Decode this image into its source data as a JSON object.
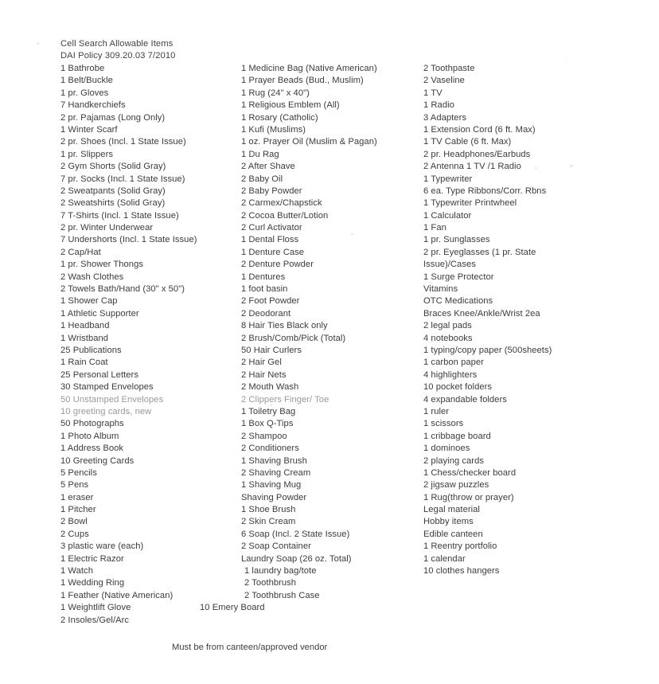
{
  "document": {
    "title": "Cell Search Allowable Items",
    "policy": "DAI Policy 309.20.03 7/2010",
    "footer_note": "Must be from canteen/approved vendor"
  },
  "columns": {
    "column_1": [
      {
        "text": "1 Bathrobe"
      },
      {
        "text": "1 Belt/Buckle"
      },
      {
        "text": "1 pr. Gloves"
      },
      {
        "text": "7 Handkerchiefs"
      },
      {
        "text": "2 pr. Pajamas (Long Only)"
      },
      {
        "text": "1 Winter Scarf"
      },
      {
        "text": "2 pr. Shoes (Incl. 1 State Issue)"
      },
      {
        "text": "1 pr. Slippers"
      },
      {
        "text": "2 Gym Shorts (Solid Gray)"
      },
      {
        "text": "7 pr. Socks (Incl. 1 State Issue)"
      },
      {
        "text": "2 Sweatpants (Solid Gray)"
      },
      {
        "text": "2 Sweatshirts (Solid Gray)"
      },
      {
        "text": "7 T-Shirts (Incl. 1 State Issue)"
      },
      {
        "text": "2 pr. Winter Underwear"
      },
      {
        "text": "7 Undershorts (Incl. 1 State Issue)"
      },
      {
        "text": "2 Cap/Hat"
      },
      {
        "text": "1 pr. Shower Thongs"
      },
      {
        "text": "2 Wash Clothes"
      },
      {
        "text": "2 Towels Bath/Hand (30\" x 50\")"
      },
      {
        "text": "1 Shower Cap"
      },
      {
        "text": "1 Athletic Supporter"
      },
      {
        "text": "1 Headband"
      },
      {
        "text": "1 Wristband"
      },
      {
        "text": "25 Publications"
      },
      {
        "text": "1 Rain Coat"
      },
      {
        "text": "25 Personal Letters"
      },
      {
        "text": "30 Stamped Envelopes"
      },
      {
        "text": "50 Unstamped Envelopes",
        "faded": true
      },
      {
        "text": "10 greeting cards, new",
        "faded": true
      },
      {
        "text": "50 Photographs"
      },
      {
        "text": "1 Photo Album"
      },
      {
        "text": "1 Address Book"
      },
      {
        "text": "10 Greeting Cards"
      },
      {
        "text": "5 Pencils"
      },
      {
        "text": "5 Pens"
      },
      {
        "text": "1 eraser"
      },
      {
        "text": "1 Pitcher"
      },
      {
        "text": "2 Bowl"
      },
      {
        "text": "2 Cups"
      },
      {
        "text": "3 plastic ware (each)"
      },
      {
        "text": "1 Electric Razor"
      },
      {
        "text": "1 Watch"
      },
      {
        "text": "1 Wedding Ring"
      },
      {
        "text": "1 Feather (Native American)"
      },
      {
        "text": "1 Weightlift Glove"
      },
      {
        "text": " 2 Insoles/Gel/Arc"
      }
    ],
    "column_2": [
      {
        "text": "1 Medicine Bag (Native American)"
      },
      {
        "text": "1 Prayer Beads (Bud., Muslim)"
      },
      {
        "text": "1 Rug (24\" x 40\")"
      },
      {
        "text": "1 Religious Emblem (All)"
      },
      {
        "text": "1 Rosary (Catholic)"
      },
      {
        "text": "1 Kufi (Muslims)"
      },
      {
        "text": "1 oz. Prayer Oil (Muslim & Pagan)"
      },
      {
        "text": "1 Du Rag"
      },
      {
        "text": "2 After Shave"
      },
      {
        "text": "2 Baby Oil"
      },
      {
        "text": "2 Baby Powder"
      },
      {
        "text": "2 Carmex/Chapstick"
      },
      {
        "text": "2 Cocoa Butter/Lotion"
      },
      {
        "text": "2 Curl Activator"
      },
      {
        "text": "1 Dental Floss"
      },
      {
        "text": "1 Denture Case"
      },
      {
        "text": "2 Denture Powder"
      },
      {
        "text": "1 Dentures"
      },
      {
        "text": "1 foot basin"
      },
      {
        "text": "2 Foot Powder"
      },
      {
        "text": "2 Deodorant"
      },
      {
        "text": "8 Hair Ties Black only"
      },
      {
        "text": "2 Brush/Comb/Pick (Total)"
      },
      {
        "text": "50 Hair Curlers"
      },
      {
        "text": "2 Hair Gel"
      },
      {
        "text": "2 Hair Nets"
      },
      {
        "text": "2 Mouth Wash"
      },
      {
        "text": "2 Clippers Finger/ Toe",
        "faded": true
      },
      {
        "text": "1 Toiletry Bag"
      },
      {
        "text": "1 Box Q-Tips"
      },
      {
        "text": "2 Shampoo"
      },
      {
        "text": "2 Conditioners"
      },
      {
        "text": "1 Shaving Brush"
      },
      {
        "text": "2 Shaving Cream"
      },
      {
        "text": "1 Shaving Mug"
      },
      {
        "text": "Shaving Powder"
      },
      {
        "text": "1 Shoe Brush"
      },
      {
        "text": "2 Skin Cream"
      },
      {
        "text": "6 Soap (Incl. 2 State Issue)"
      },
      {
        "text": "2 Soap Container"
      },
      {
        "text": "Laundry Soap (26 oz. Total)"
      },
      {
        "text": "1 laundry bag/tote",
        "drift": true
      },
      {
        "text": "2 Toothbrush",
        "drift": true
      },
      {
        "text": "2 Toothbrush Case",
        "drift": true
      },
      {
        "text": "10 Emery Board",
        "outdent": true
      }
    ],
    "column_3": [
      {
        "text": "2 Toothpaste"
      },
      {
        "text": "2 Vaseline"
      },
      {
        "text": "1 TV"
      },
      {
        "text": "1 Radio"
      },
      {
        "text": "3 Adapters"
      },
      {
        "text": "1 Extension Cord (6 ft. Max)"
      },
      {
        "text": "1 TV Cable (6 ft. Max)"
      },
      {
        "text": "2 pr. Headphones/Earbuds"
      },
      {
        "text": "2 Antenna 1 TV /1 Radio"
      },
      {
        "text": "1 Typewriter"
      },
      {
        "text": "6 ea. Type Ribbons/Corr. Rbns"
      },
      {
        "text": "1 Typewriter Printwheel"
      },
      {
        "text": "1 Calculator"
      },
      {
        "text": "1 Fan"
      },
      {
        "text": "1 pr. Sunglasses"
      },
      {
        "text": "2 pr. Eyeglasses (1 pr. State"
      },
      {
        "text": "Issue)/Cases",
        "continuation": true
      },
      {
        "text": "1 Surge Protector"
      },
      {
        "text": "Vitamins"
      },
      {
        "text": "OTC Medications"
      },
      {
        "text": "Braces Knee/Ankle/Wrist 2ea"
      },
      {
        "text": "2 legal pads"
      },
      {
        "text": "4 notebooks"
      },
      {
        "text": "1 typing/copy paper (500sheets)"
      },
      {
        "text": "1 carbon paper"
      },
      {
        "text": "4 highlighters"
      },
      {
        "text": "10 pocket folders"
      },
      {
        "text": "4 expandable folders"
      },
      {
        "text": "1 ruler"
      },
      {
        "text": "1 scissors"
      },
      {
        "text": "1 cribbage board"
      },
      {
        "text": "1 dominoes"
      },
      {
        "text": "2 playing cards"
      },
      {
        "text": "1 Chess/checker board"
      },
      {
        "text": "2 jigsaw puzzles"
      },
      {
        "text": "1 Rug(throw or prayer)"
      },
      {
        "text": "Legal material"
      },
      {
        "text": "Hobby items"
      },
      {
        "text": "Edible canteen"
      },
      {
        "text": "1 Reentry portfolio"
      },
      {
        "text": "1 calendar"
      },
      {
        "text": "10 clothes hangers"
      }
    ]
  }
}
